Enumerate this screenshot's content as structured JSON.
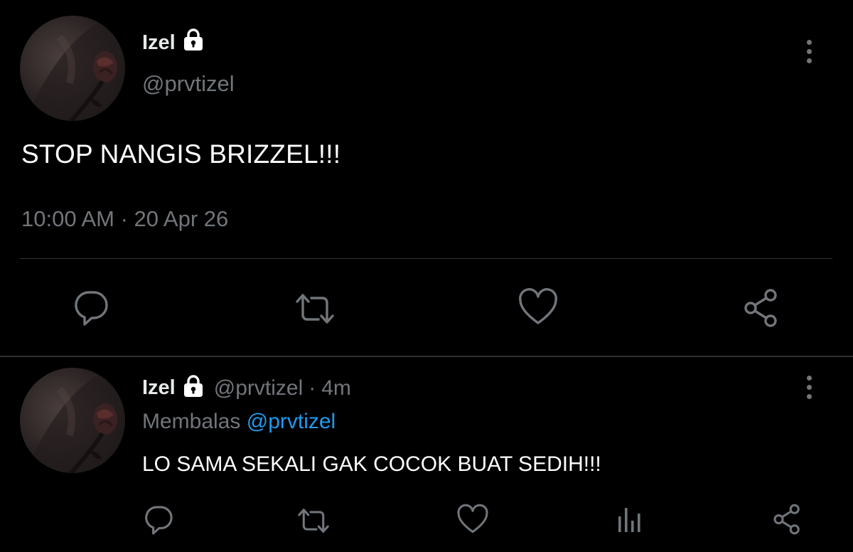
{
  "main_tweet": {
    "author": {
      "display_name": "Izel",
      "handle": "@prvtizel",
      "protected_icon": "lock-icon",
      "avatar_icon": "rose-avatar"
    },
    "text": "STOP NANGIS BRIZZEL!!!",
    "timestamp": "10:00 AM · 20 Apr 26",
    "actions": [
      "reply-icon",
      "retweet-icon",
      "like-icon",
      "share-icon"
    ],
    "menu_icon": "more-vertical-icon"
  },
  "reply_tweet": {
    "author": {
      "display_name": "Izel",
      "handle": "@prvtizel",
      "protected_icon": "lock-icon",
      "avatar_icon": "rose-avatar"
    },
    "separator": "·",
    "relative_time": "4m",
    "replying_label": "Membalas",
    "replying_to": "@prvtizel",
    "text": "LO SAMA SEKALI GAK COCOK BUAT SEDIH!!!",
    "actions": [
      "reply-icon",
      "retweet-icon",
      "like-icon",
      "analytics-icon",
      "share-icon"
    ],
    "menu_icon": "more-vertical-icon"
  },
  "colors": {
    "background": "#000000",
    "text_primary": "#e7e9ea",
    "text_secondary": "#71767b",
    "accent": "#1d9bf0",
    "divider": "#2f3336"
  }
}
